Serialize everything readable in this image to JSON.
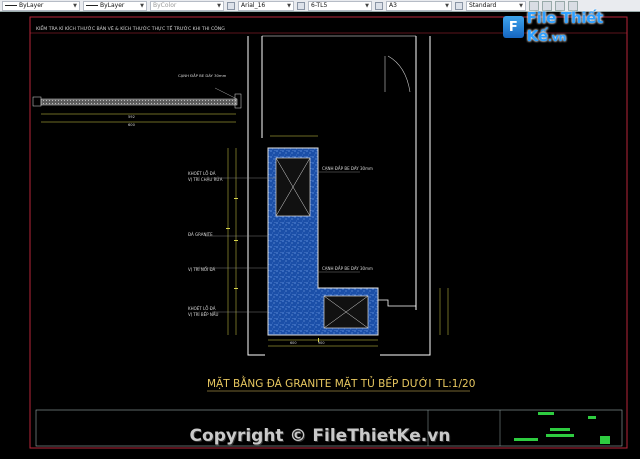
{
  "toolbar": {
    "layer_value": "ByLayer",
    "linetype_value": "ByLayer",
    "color_value": "ByColor",
    "text_style_value": "Arial_16",
    "dim_style_value": "6-TL5",
    "paper_value": "A3",
    "table_style_value": "Standard"
  },
  "drawing": {
    "header_note": "KIỂM TRA KÍ KÍCH THƯỚC BẢN VẼ & KÍCH THƯỚC THỰC TẾ TRƯỚC KHI THI CÔNG",
    "section_label": "CẠNH ĐẮP BE DÀY 30mm",
    "section_dim_1": "592",
    "section_dim_2": "600",
    "label_sink_cutout_1": "KHOÉT LỖ ĐÁ",
    "label_sink_cutout_2": "VỊ TRÍ CHẬU RỬA",
    "label_granite": "ĐÁ GRANITE",
    "label_joint": "VỊ TRÍ NỐI ĐÁ",
    "label_hob_cutout_1": "KHOÉT LỖ ĐÁ",
    "label_hob_cutout_2": "VỊ TRÍ BẾP NẤU",
    "label_edge_top": "CẠNH ĐẮP BE DÀY 30mm",
    "label_edge_mid": "CẠNH ĐẮP BE DÀY 30mm",
    "title": "MẶT BẰNG ĐÁ GRANITE MẶT TỦ BẾP DƯỚI",
    "scale": "TL:1/20",
    "dim_bottom_1": "600",
    "dim_bottom_2": "900"
  },
  "watermark": {
    "logo_badge": "F",
    "logo_text": "File Thiết Kế",
    "logo_domain": ".vn",
    "copyright": "Copyright © FileThietKe.vn"
  },
  "colors": {
    "background": "#000000",
    "wall_lines": "#ffffff",
    "granite_fill": "#1e56b0",
    "dimension_lines": "#d8d44a",
    "border_red": "#b8263a",
    "title_text": "#e8c860",
    "label_text": "#d8d8d8"
  }
}
